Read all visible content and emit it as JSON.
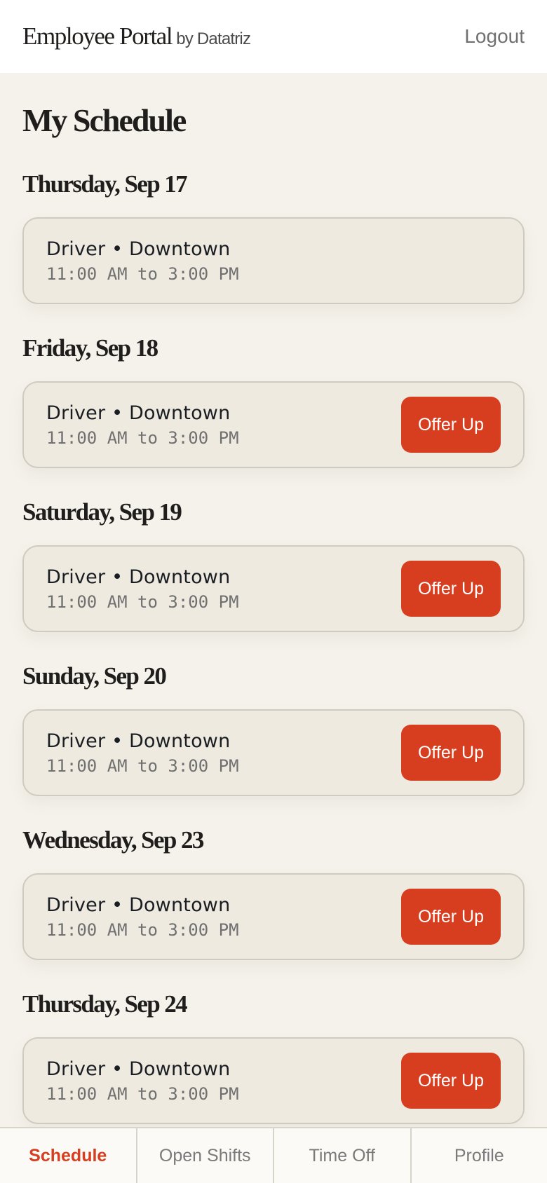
{
  "header": {
    "title": "Employee Portal",
    "subtitle": "by Datatriz",
    "logout_label": "Logout"
  },
  "main": {
    "page_title": "My Schedule",
    "days": [
      {
        "heading": "Thursday, Sep 17",
        "shift": {
          "role": "Driver • Downtown",
          "time": "11:00 AM to 3:00 PM",
          "action": ""
        }
      },
      {
        "heading": "Friday, Sep 18",
        "shift": {
          "role": "Driver • Downtown",
          "time": "11:00 AM to 3:00 PM",
          "action": "Offer Up"
        }
      },
      {
        "heading": "Saturday, Sep 19",
        "shift": {
          "role": "Driver • Downtown",
          "time": "11:00 AM to 3:00 PM",
          "action": "Offer Up"
        }
      },
      {
        "heading": "Sunday, Sep 20",
        "shift": {
          "role": "Driver • Downtown",
          "time": "11:00 AM to 3:00 PM",
          "action": "Offer Up"
        }
      },
      {
        "heading": "Wednesday, Sep 23",
        "shift": {
          "role": "Driver • Downtown",
          "time": "11:00 AM to 3:00 PM",
          "action": "Offer Up"
        }
      },
      {
        "heading": "Thursday, Sep 24",
        "shift": {
          "role": "Driver • Downtown",
          "time": "11:00 AM to 3:00 PM",
          "action": "Offer Up"
        }
      }
    ]
  },
  "bottom_nav": {
    "tabs": [
      {
        "label": "Schedule",
        "active": true
      },
      {
        "label": "Open Shifts",
        "active": false
      },
      {
        "label": "Time Off",
        "active": false
      },
      {
        "label": "Profile",
        "active": false
      }
    ]
  },
  "colors": {
    "accent": "#d63e1f",
    "background": "#f5f2eb",
    "card": "#eeeae0"
  }
}
